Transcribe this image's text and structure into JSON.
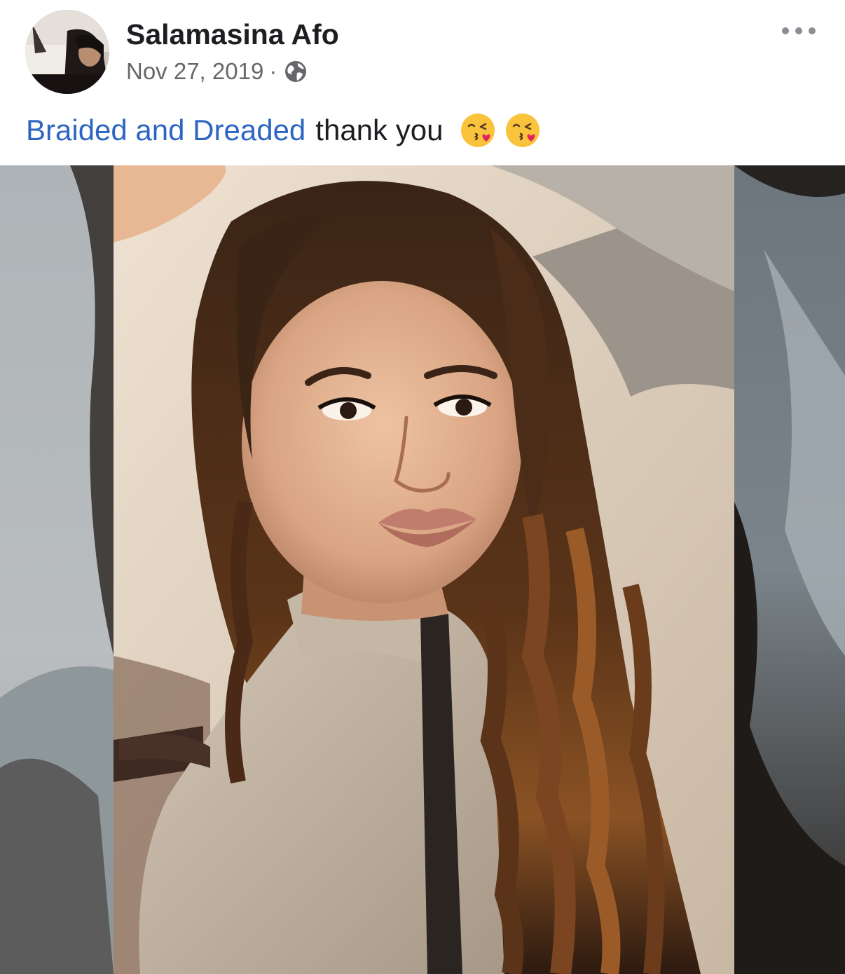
{
  "post": {
    "author_name": "Salamasina Afo",
    "timestamp": "Nov 27, 2019",
    "separator": "·",
    "privacy_icon": "globe-icon",
    "more_icon": "more-options-icon",
    "caption": {
      "mention": "Braided and Dreaded",
      "text": "thank you",
      "emojis": [
        "face-blowing-kiss",
        "face-blowing-kiss"
      ]
    },
    "photo_subject": "woman-selfie-with-long-curly-hair"
  },
  "colors": {
    "mention_link": "#2d66c2",
    "primary_text": "#1c1e21",
    "secondary_text": "#65676b",
    "background": "#ffffff"
  }
}
